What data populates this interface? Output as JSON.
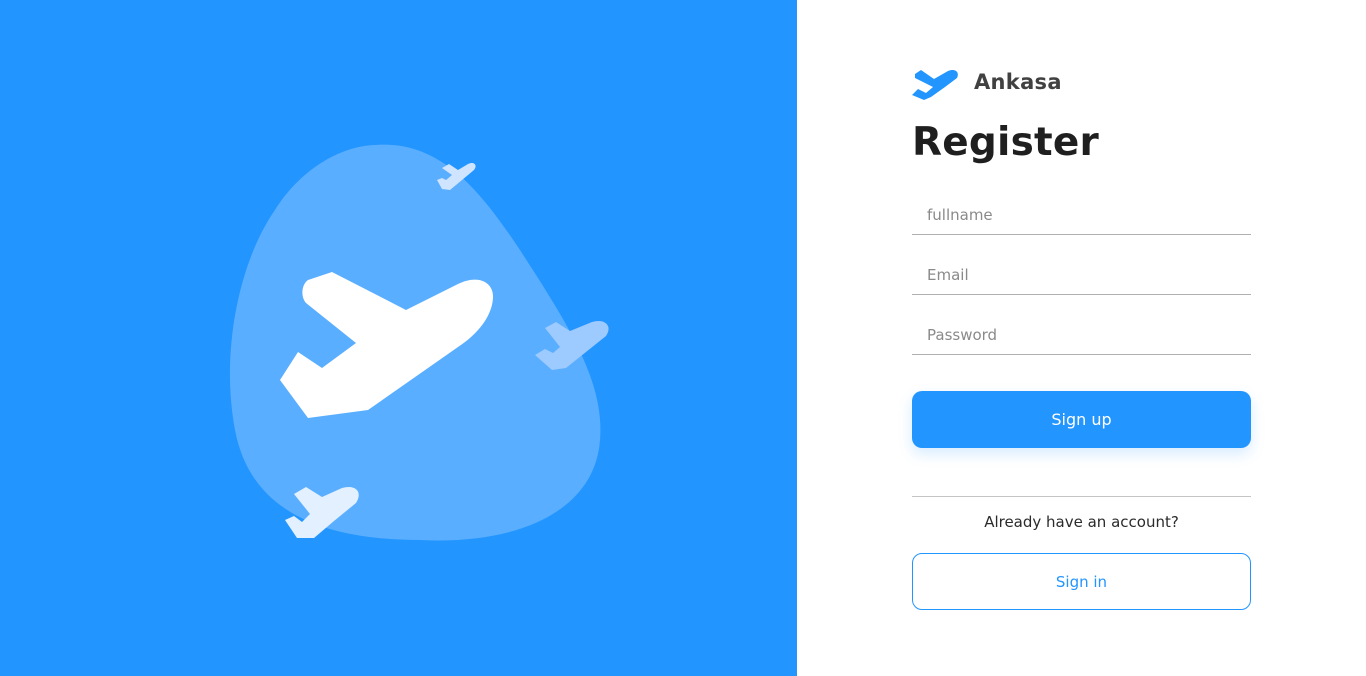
{
  "brand": {
    "name": "Ankasa",
    "logo_icon": "airplane-logo-icon"
  },
  "form": {
    "title": "Register",
    "fullname_placeholder": "fullname",
    "fullname_value": "",
    "email_placeholder": "Email",
    "email_value": "",
    "password_placeholder": "Password",
    "password_value": "",
    "submit_label": "Sign up",
    "account_prompt": "Already have an account?",
    "signin_label": "Sign in"
  },
  "hero": {
    "illustration_icon": "airplane-illustration-icon",
    "small_plane_icons": [
      "small-plane-icon-top",
      "small-plane-icon-right",
      "small-plane-icon-bottom"
    ]
  },
  "colors": {
    "primary": "#2395FF",
    "blob": "#5AAEFF",
    "title": "#1f1f1f",
    "brand_text": "#414141",
    "white": "#FFFFFF"
  }
}
